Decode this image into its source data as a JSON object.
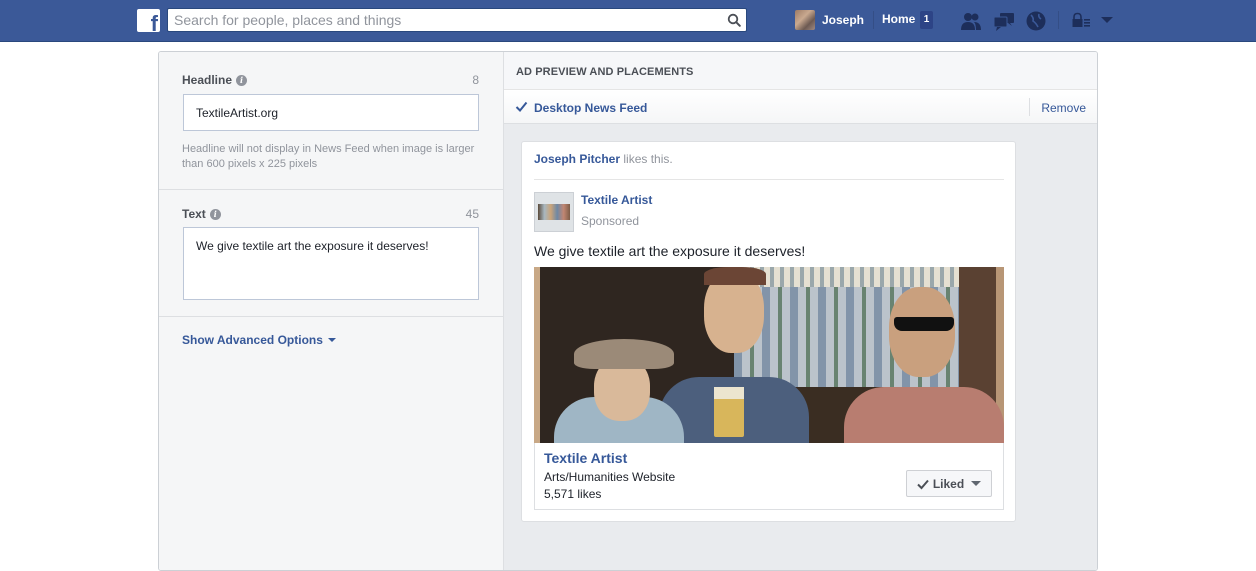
{
  "topbar": {
    "logo_letter": "f",
    "search_placeholder": "Search for people, places and things",
    "profile_name": "Joseph",
    "home_label": "Home",
    "home_count": "1",
    "icons": [
      "friend-requests-icon",
      "messages-icon",
      "notifications-globe-icon",
      "privacy-shortcuts-icon",
      "account-menu-chevron-icon"
    ]
  },
  "colors": {
    "brand_blue": "#3b5998",
    "link_blue": "#365899",
    "muted_gray": "#90949c"
  },
  "editor": {
    "headline": {
      "label": "Headline",
      "char_count": "8",
      "value": "TextileArtist.org",
      "helper": "Headline will not display in News Feed when image is larger than 600 pixels x 225 pixels"
    },
    "text": {
      "label": "Text",
      "char_count": "45",
      "value": "We give textile art the exposure it deserves!"
    },
    "advanced_label": "Show Advanced Options"
  },
  "preview": {
    "section_title": "AD PREVIEW AND PLACEMENTS",
    "placement_label": "Desktop News Feed",
    "remove_label": "Remove",
    "card": {
      "social_name": "Joseph Pitcher",
      "social_suffix": " likes this.",
      "page_name": "Textile Artist",
      "sponsored": "Sponsored",
      "body_text": "We give textile art the exposure it deserves!",
      "image_alt": "Textile artwork of three men at a bar",
      "footer_title": "Textile Artist",
      "footer_category": "Arts/Humanities Website",
      "footer_likes": "5,571 likes",
      "liked_label": "Liked"
    }
  }
}
